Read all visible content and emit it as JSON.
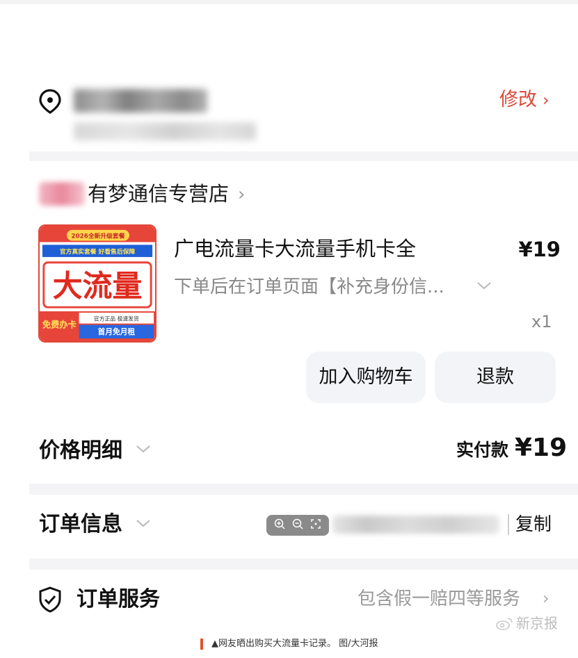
{
  "address": {
    "modify_label": "修改",
    "modify_chevron": "›",
    "location_icon": "location-pin-icon"
  },
  "shop": {
    "name": "有梦通信专营店",
    "chevron": "›"
  },
  "product": {
    "image_texts": {
      "top_badge": "2026全新升级套餐",
      "slogan": "官方真实套餐 好看售后保障",
      "headline": "大流量",
      "corner": "免费办卡",
      "line1": "官方正品 极速发货",
      "line2": "首月免月租"
    },
    "title": "广电流量卡大流量手机卡全",
    "price": "¥19",
    "spec": "下单后在订单页面【补充身份信...",
    "quantity": "x1",
    "add_to_cart_label": "加入购物车",
    "refund_label": "退款"
  },
  "price_detail": {
    "title": "价格明细",
    "paid_label": "实付款",
    "paid_amount": "¥19"
  },
  "order_info": {
    "title": "订单信息",
    "copy_label": "复制"
  },
  "service": {
    "title": "订单服务",
    "description": "包含假一赔四等服务",
    "chevron": "›"
  },
  "watermark": "新京报",
  "caption": "▲网友晒出购买大流量卡记录。 图/大河报",
  "colors": {
    "accent_red": "#d94a38",
    "button_bg": "#f3f4f8",
    "muted_text": "#888888",
    "divider": "#f4f4f6"
  }
}
